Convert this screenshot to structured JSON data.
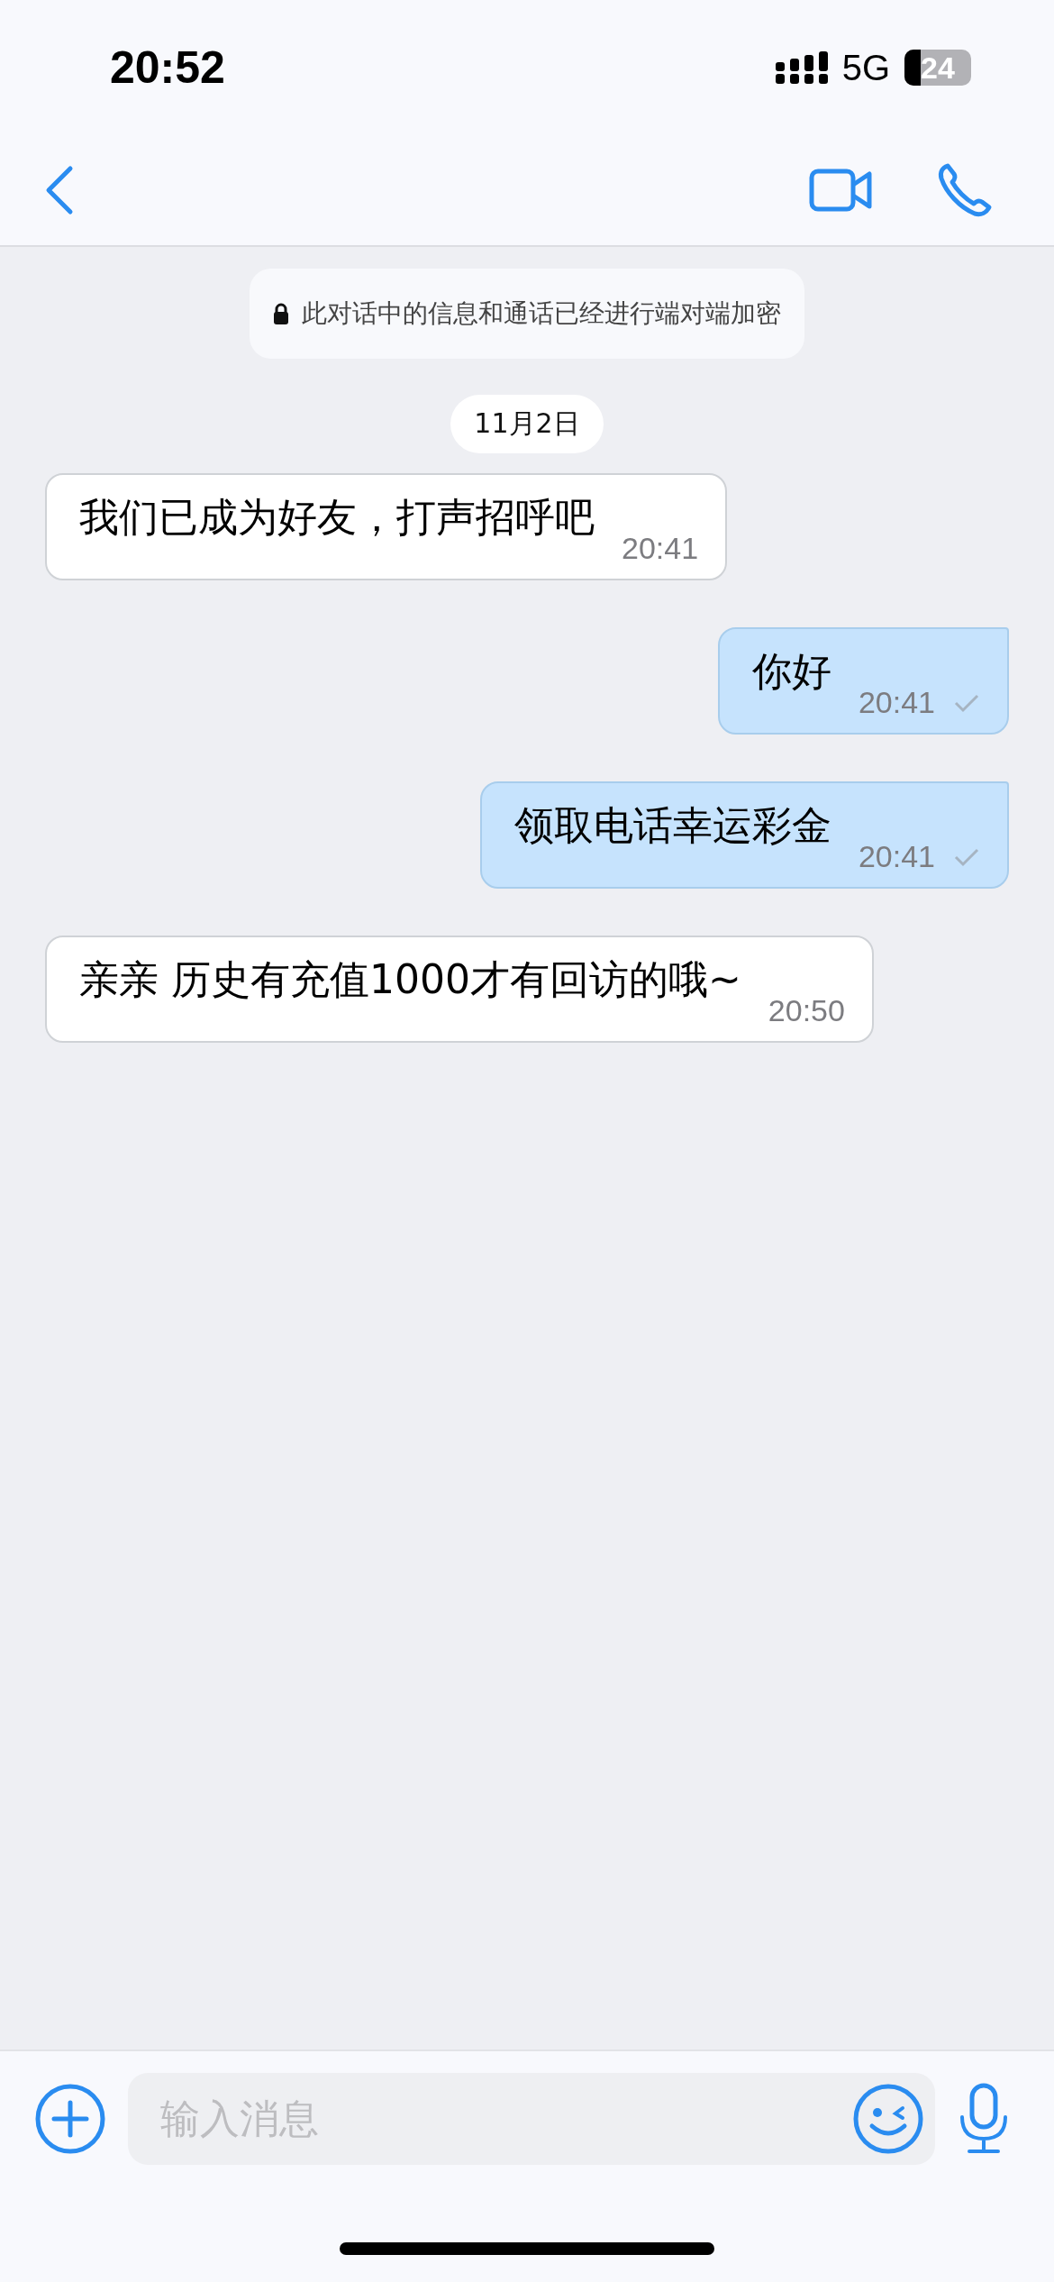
{
  "status_bar": {
    "time": "20:52",
    "network": "5G",
    "battery": "24"
  },
  "notice": "此对话中的信息和通话已经进行端对端加密",
  "date": "11月2日",
  "messages": [
    {
      "kind": "received",
      "text": "我们已成为好友，打声招呼吧",
      "time": "20:41",
      "delivered": false
    },
    {
      "kind": "sent",
      "text": "你好",
      "time": "20:41",
      "delivered": true
    },
    {
      "kind": "sent",
      "text": "领取电话幸运彩金",
      "time": "20:41",
      "delivered": true
    },
    {
      "kind": "received",
      "text": "亲亲 历史有充值1000才有回访的哦~",
      "time": "20:50",
      "delivered": false
    }
  ],
  "composer": {
    "placeholder": "输入消息"
  }
}
